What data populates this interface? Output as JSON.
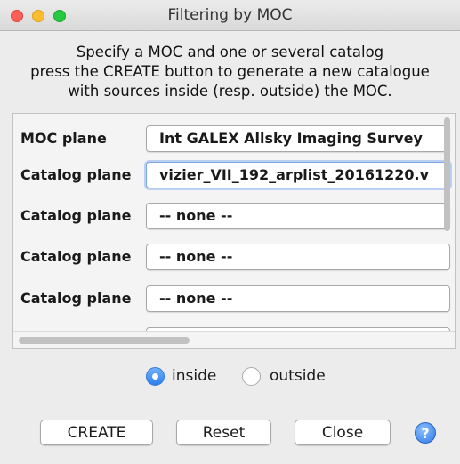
{
  "window": {
    "title": "Filtering by MOC"
  },
  "instructions": {
    "line1": "Specify a MOC and one or several catalog",
    "line2": "press the CREATE button to generate a new catalogue",
    "line3": "with sources inside (resp. outside) the MOC."
  },
  "planes": [
    {
      "label": "MOC plane",
      "value": "Int GALEX Allsky Imaging Survey"
    },
    {
      "label": "Catalog plane",
      "value": "vizier_VII_192_arplist_20161220.v"
    },
    {
      "label": "Catalog plane",
      "value": "-- none --"
    },
    {
      "label": "Catalog plane",
      "value": "-- none --"
    },
    {
      "label": "Catalog plane",
      "value": "-- none --"
    }
  ],
  "mode": {
    "selected": "inside",
    "inside_label": "inside",
    "outside_label": "outside"
  },
  "buttons": {
    "create": "CREATE",
    "reset": "Reset",
    "close": "Close",
    "help": "?"
  }
}
